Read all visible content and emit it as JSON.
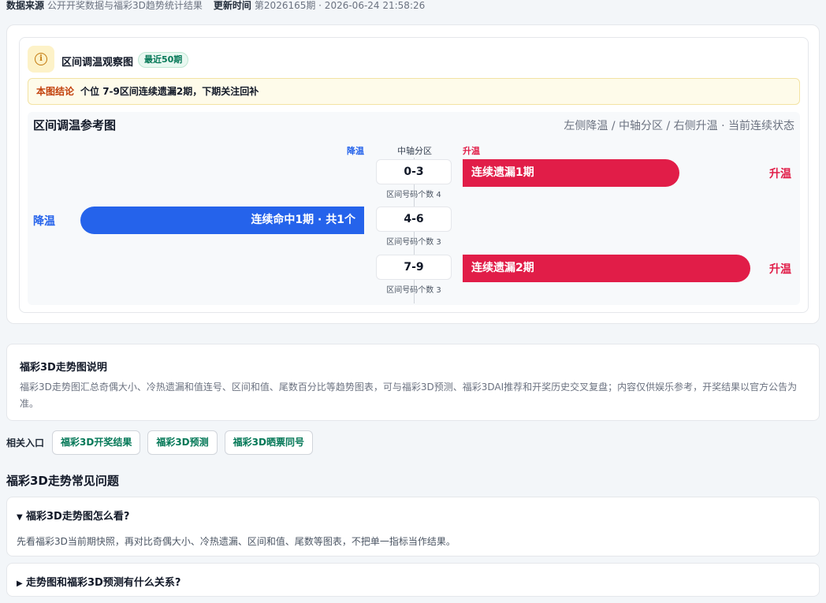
{
  "meta": {
    "source_label": "数据来源",
    "source_value": "公开开奖数据与福彩3D趋势统计结果",
    "update_label": "更新时间",
    "update_value": "第2026165期 · 2026-06-24 21:58:26"
  },
  "card": {
    "title": "区间调温观察图",
    "badge": "最近50期",
    "conclusion_tag": "本图结论",
    "conclusion_text": "个位 7-9区间连续遗漏2期，下期关注回补"
  },
  "chart_data": {
    "type": "bar",
    "title": "区间调温参考图",
    "subtitle": "左侧降温 / 中轴分区 / 右侧升温 · 当前连续状态",
    "header_cool": "降温",
    "header_axis": "中轴分区",
    "header_warm": "升温",
    "count_label": "区间号码个数",
    "rows": [
      {
        "zone": "0-3",
        "count": 4,
        "direction": "升温",
        "bar_label": "连续遗漏1期",
        "streak": 1
      },
      {
        "zone": "4-6",
        "count": 3,
        "direction": "降温",
        "bar_label": "连续命中1期 · 共1个",
        "streak": 1
      },
      {
        "zone": "7-9",
        "count": 3,
        "direction": "升温",
        "bar_label": "连续遗漏2期",
        "streak": 2
      }
    ],
    "colors": {
      "warm": "#e11d48",
      "cool": "#2563eb"
    }
  },
  "description": {
    "title": "福彩3D走势图说明",
    "text": "福彩3D走势图汇总奇偶大小、冷热遗漏和值连号、区间和值、尾数百分比等趋势图表，可与福彩3D预测、福彩3DAI推荐和开奖历史交叉复盘；内容仅供娱乐参考，开奖结果以官方公告为准。"
  },
  "related": {
    "label": "相关入口",
    "links": [
      "福彩3D开奖结果",
      "福彩3D预测",
      "福彩3D晒票同号"
    ]
  },
  "faq": {
    "title": "福彩3D走势常见问题",
    "items": [
      {
        "question": "福彩3D走势图怎么看?",
        "answer": "先看福彩3D当前期快照，再对比奇偶大小、冷热遗漏、区间和值、尾数等图表，不把单一指标当作结果。",
        "expanded": true
      },
      {
        "question": "走势图和福彩3D预测有什么关系?",
        "expanded": false
      }
    ]
  }
}
